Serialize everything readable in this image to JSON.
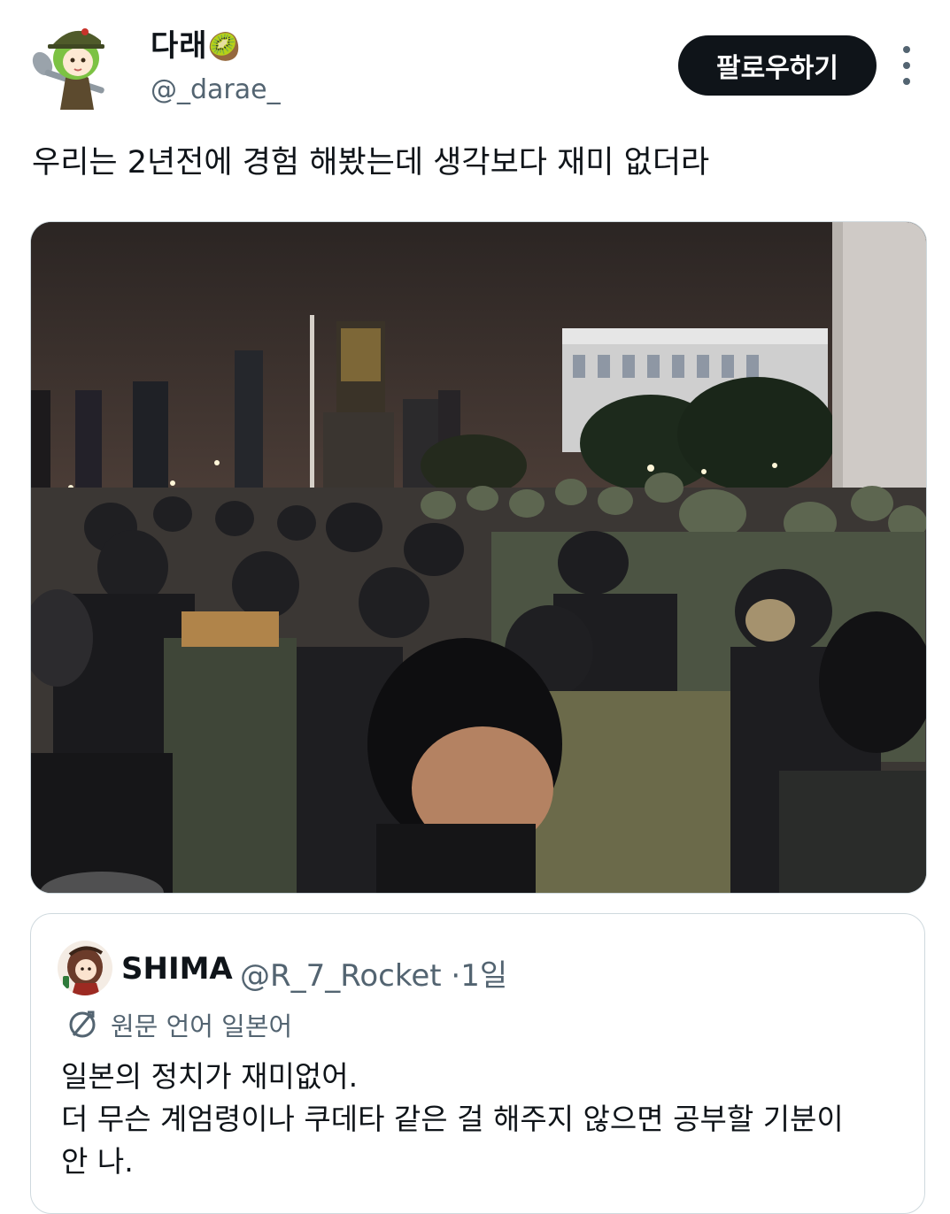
{
  "author": {
    "display_name": "다래",
    "name_emoji": "🥝",
    "handle": "@_darae_",
    "avatar_icon": "avatar-character-with-spoon"
  },
  "follow_button_label": "팔로우하기",
  "more_icon": "more-vertical-icon",
  "tweet": {
    "text": "우리는 2년전에 경험 해봤는데 생각보다 재미 없더라",
    "media": "photo-crowd-of-soldiers-and-people-at-night"
  },
  "quoted_tweet": {
    "display_name": "SHIMA",
    "handle": "@R_7_Rocket",
    "separator": "·",
    "time": "1일",
    "translate_icon": "translate-icon",
    "translate_label": "원문 언어 일본어",
    "lines": [
      "일본의 정치가 재미없어.",
      "더 무슨 계엄령이나 쿠데타 같은 걸 해주지 않으면 공부할 기분이",
      "안 나."
    ]
  },
  "colors": {
    "text_primary": "#0f1419",
    "text_secondary": "#536471",
    "border": "#cfd9de",
    "button_bg": "#0f1419"
  }
}
